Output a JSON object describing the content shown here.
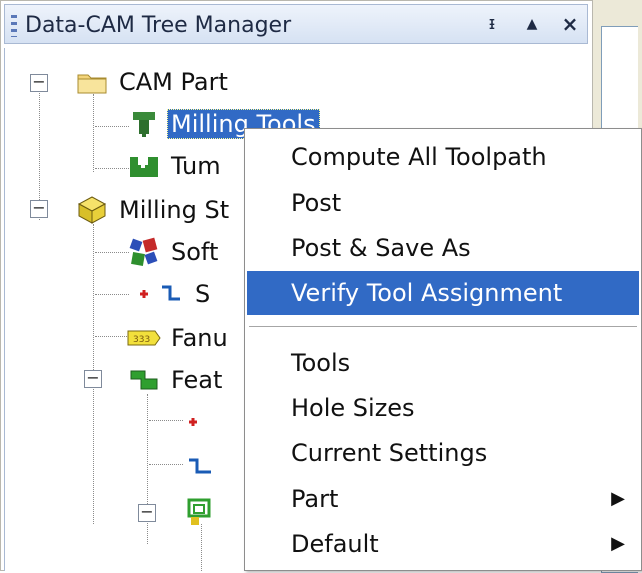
{
  "window": {
    "title": "Data-CAM Tree Manager",
    "buttons": {
      "pin": "ᵻ",
      "up": "▲",
      "close": "×"
    }
  },
  "tree": {
    "items": [
      {
        "label": "CAM Part",
        "icon": "folder-icon"
      },
      {
        "label": "Milling Tools",
        "icon": "milling-tool-icon",
        "selected": true
      },
      {
        "label": "Tum",
        "icon": "turning-tool-icon"
      },
      {
        "label": "Milling St",
        "icon": "stock-cube-icon"
      },
      {
        "label": "Soft",
        "icon": "gears-icon"
      },
      {
        "label": "S",
        "icon": "setup-axis-icon"
      },
      {
        "label": "Fanu",
        "icon": "post-processor-icon"
      },
      {
        "label": "Feat",
        "icon": "features-icon"
      }
    ]
  },
  "context_menu": {
    "items": [
      {
        "label": "Compute All Toolpath"
      },
      {
        "label": "Post"
      },
      {
        "label": "Post & Save As"
      },
      {
        "label": "Verify Tool Assignment",
        "highlighted": true
      },
      {
        "label": "Tools"
      },
      {
        "label": "Hole Sizes"
      },
      {
        "label": "Current Settings"
      },
      {
        "label": "Part",
        "submenu_arrow": "▶"
      },
      {
        "label": "Default",
        "submenu_arrow": "▶"
      }
    ]
  },
  "colors": {
    "highlight": "#316ac5",
    "titlebar": "#d6e2f3"
  }
}
